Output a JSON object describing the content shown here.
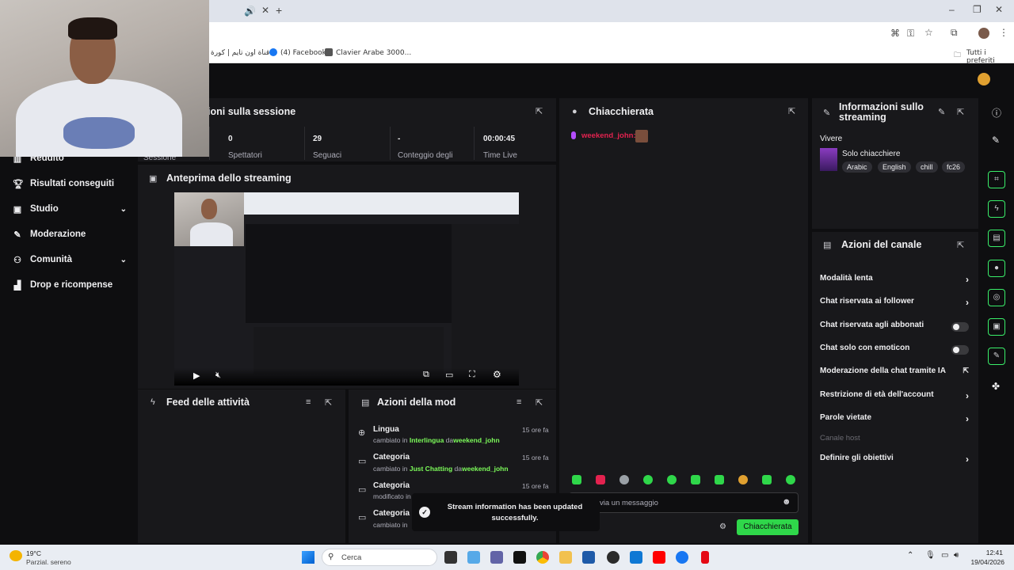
{
  "browser": {
    "bookmarks": [
      "قناة اون تايم | كورة",
      "(4) Facebook",
      "Clavier Arabe 3000...",
      "Tutti i preferiti"
    ]
  },
  "sidebar": {
    "items": [
      {
        "label": "Reddito",
        "icon": "chart-icon"
      },
      {
        "label": "Risultati conseguiti",
        "icon": "trophy-icon"
      },
      {
        "label": "Studio",
        "icon": "studio-icon"
      },
      {
        "label": "Moderazione",
        "icon": "wrench-icon"
      },
      {
        "label": "Comunità",
        "icon": "people-icon"
      },
      {
        "label": "Drop e ricompense",
        "icon": "gift-icon"
      }
    ]
  },
  "session": {
    "title": "ioni sulla sessione",
    "stats": [
      {
        "value": "",
        "label": "Sessione"
      },
      {
        "value": "0",
        "label": "Spettatori"
      },
      {
        "value": "29",
        "label": "Seguaci"
      },
      {
        "value": "-",
        "label": "Conteggio degli"
      },
      {
        "value": "00:00:45",
        "label": "Time Live"
      }
    ]
  },
  "preview": {
    "title": "Anteprima dello streaming"
  },
  "activity": {
    "title": "Feed delle attività"
  },
  "mod_actions": {
    "title": "Azioni della mod",
    "items": [
      {
        "title": "Lingua",
        "prefix": "cambiato in ",
        "value": "Interlingua",
        "by": " da",
        "user": "weekend_john",
        "time": "15 ore fa"
      },
      {
        "title": "Categoria",
        "prefix": "cambiato in ",
        "value": "Just Chatting",
        "by": " da",
        "user": "weekend_john",
        "time": "15 ore fa"
      },
      {
        "title": "Categoria",
        "prefix": "modificato in",
        "value": "",
        "by": "",
        "user": "",
        "time": "15 ore fa"
      },
      {
        "title": "Categoria",
        "prefix": "cambiato in ",
        "value": "",
        "by": "",
        "user": "",
        "time": ""
      }
    ]
  },
  "chat": {
    "title": "Chiacchierata",
    "message_user": "weekend_john:",
    "placeholder": "via un messaggio",
    "send_label": "Chiacchierata"
  },
  "stream_info": {
    "title": "Informazioni sullo streaming",
    "status": "Vivere",
    "category": "Solo chiacchiere",
    "tags": [
      "Arabic",
      "English",
      "chill",
      "fc26"
    ]
  },
  "channel_actions": {
    "title": "Azioni del canale",
    "items": [
      {
        "label": "Modalità lenta",
        "control": "chevron"
      },
      {
        "label": "Chat riservata ai follower",
        "control": "chevron"
      },
      {
        "label": "Chat riservata agli abbonati",
        "control": "toggle"
      },
      {
        "label": "Chat solo con emoticon",
        "control": "toggle"
      },
      {
        "label": "Moderazione della chat tramite IA",
        "control": "external"
      },
      {
        "label": "Restrizione di età dell'account",
        "control": "chevron"
      },
      {
        "label": "Parole vietate",
        "control": "chevron"
      },
      {
        "label": "Canale host",
        "control": "none"
      },
      {
        "label": "Definire gli obiettivi",
        "control": "chevron"
      }
    ]
  },
  "toast": {
    "message": "Stream information has been updated successfully."
  },
  "taskbar": {
    "weather_temp": "19°C",
    "weather_desc": "Parzial. sereno",
    "search_placeholder": "Cerca",
    "time": "12:41",
    "date": "19/04/2026"
  },
  "colors": {
    "accent": "#2fd74a",
    "background": "#0e0e10",
    "panel": "#18181b",
    "username": "#e3224f"
  }
}
